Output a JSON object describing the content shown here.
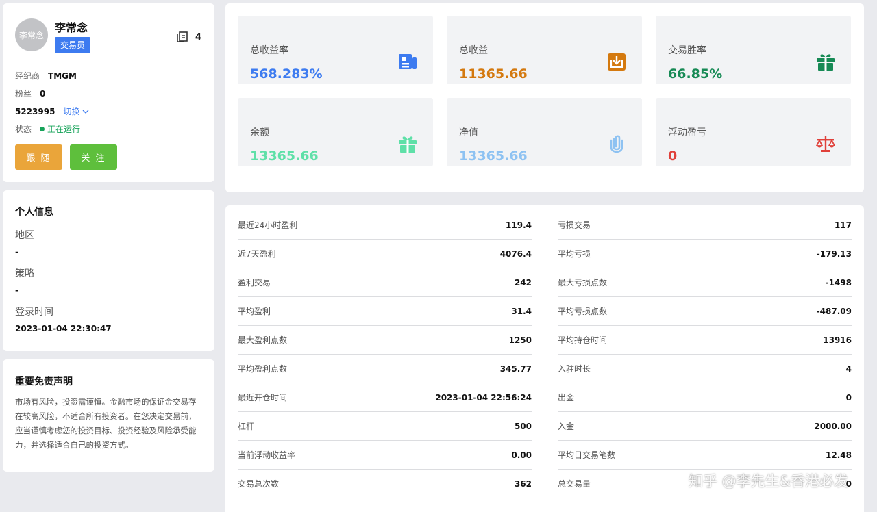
{
  "profile": {
    "avatar_text": "李常念",
    "name": "李常念",
    "role": "交易员",
    "copy_count": "4",
    "broker_label": "经纪商",
    "broker": "TMGM",
    "fans_label": "粉丝",
    "fans": "0",
    "account": "5223995",
    "switch_label": "切换",
    "status_label": "状态",
    "status": "正在运行",
    "follow_button": "跟 随",
    "watch_button": "关 注"
  },
  "info": {
    "title": "个人信息",
    "region_label": "地区",
    "region": "-",
    "strategy_label": "策略",
    "strategy": "-",
    "login_label": "登录时间",
    "login_time": "2023-01-04 22:30:47"
  },
  "disclaimer": {
    "title": "重要免责声明",
    "text": "市场有风险，投资需谨慎。金融市场的保证金交易存在较高风险，不适合所有投资者。在您决定交易前，应当谨慎考虑您的投资目标、投资经验及风险承受能力，并选择适合自己的投资方式。"
  },
  "stats": [
    {
      "label": "总收益率",
      "value": "568.283%",
      "color": "#3d7bf0",
      "icon": "news-icon"
    },
    {
      "label": "总收益",
      "value": "11365.66",
      "color": "#d4790f",
      "icon": "download-box-icon"
    },
    {
      "label": "交易胜率",
      "value": "66.85%",
      "color": "#178a55",
      "icon": "gift-icon"
    },
    {
      "label": "余额",
      "value": "13365.66",
      "color": "#5fe0a8",
      "icon": "gift-icon"
    },
    {
      "label": "净值",
      "value": "13365.66",
      "color": "#8ec2f2",
      "icon": "paperclip-icon"
    },
    {
      "label": "浮动盈亏",
      "value": "0",
      "color": "#e0403a",
      "icon": "scale-icon"
    }
  ],
  "details_left": [
    {
      "label": "最近24小时盈利",
      "value": "119.4"
    },
    {
      "label": "近7天盈利",
      "value": "4076.4"
    },
    {
      "label": "盈利交易",
      "value": "242"
    },
    {
      "label": "平均盈利",
      "value": "31.4"
    },
    {
      "label": "最大盈利点数",
      "value": "1250"
    },
    {
      "label": "平均盈利点数",
      "value": "345.77"
    },
    {
      "label": "最近开仓时间",
      "value": "2023-01-04 22:56:24"
    },
    {
      "label": "杠杆",
      "value": "500"
    },
    {
      "label": "当前浮动收益率",
      "value": "0.00"
    },
    {
      "label": "交易总次数",
      "value": "362"
    }
  ],
  "details_right": [
    {
      "label": "亏损交易",
      "value": "117"
    },
    {
      "label": "平均亏损",
      "value": "-179.13"
    },
    {
      "label": "最大亏损点数",
      "value": "-1498"
    },
    {
      "label": "平均亏损点数",
      "value": "-487.09"
    },
    {
      "label": "平均持仓时间",
      "value": "13916"
    },
    {
      "label": "入驻时长",
      "value": "4"
    },
    {
      "label": "出金",
      "value": "0"
    },
    {
      "label": "入金",
      "value": "2000.00"
    },
    {
      "label": "平均日交易笔数",
      "value": "12.48"
    },
    {
      "label": "总交易量",
      "value": "0"
    }
  ],
  "watermark": "知乎 @李先生&香港必发"
}
